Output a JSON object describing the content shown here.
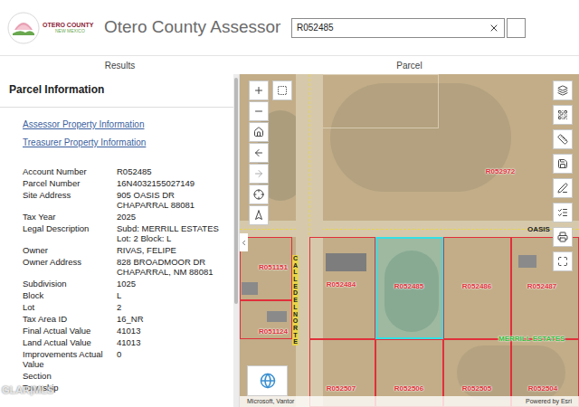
{
  "header": {
    "logo": {
      "line1": "OTERO COUNTY",
      "line2": "NEW MEXICO"
    },
    "title": "Otero County Assessor",
    "search": {
      "value": "R052485"
    }
  },
  "panes": [
    {
      "label": "Results"
    },
    {
      "label": "Parcel"
    }
  ],
  "parcel_info": {
    "title": "Parcel Information",
    "links": [
      "Assessor Property Information",
      "Treasurer Property Information"
    ],
    "fields": [
      {
        "label": "Account Number",
        "value": [
          "R052485"
        ]
      },
      {
        "label": "Parcel Number",
        "value": [
          "16N4032155027149"
        ]
      },
      {
        "label": "Site Address",
        "value": [
          "905 OASIS DR",
          "CHAPARRAL 88081"
        ]
      },
      {
        "label": "Tax Year",
        "value": [
          "2025"
        ]
      },
      {
        "label": "Legal Description",
        "value": [
          "Subd: MERRILL ESTATES",
          "Lot: 2 Block: L"
        ]
      },
      {
        "label": "Owner",
        "value": [
          "RIVAS, FELIPE"
        ]
      },
      {
        "label": "Owner Address",
        "value": [
          "828 BROADMOOR DR",
          "CHAPARRAL, NM 88081"
        ]
      },
      {
        "label": "Subdivision",
        "value": [
          "1025"
        ]
      },
      {
        "label": "Block",
        "value": [
          "L"
        ]
      },
      {
        "label": "Lot",
        "value": [
          "2"
        ]
      },
      {
        "label": "Tax Area ID",
        "value": [
          "16_NR"
        ]
      },
      {
        "label": "Final Actual Value",
        "value": [
          "41013"
        ]
      },
      {
        "label": "Land Actual Value",
        "value": [
          "41013"
        ]
      },
      {
        "label": "Improvements Actual Value",
        "value": [
          "0"
        ]
      },
      {
        "label": "Section",
        "value": []
      },
      {
        "label": "Township",
        "value": []
      }
    ]
  },
  "map": {
    "parcels": [
      {
        "label": "R052972",
        "selected": false
      },
      {
        "label": "R052484",
        "selected": false
      },
      {
        "label": "R052485",
        "selected": true
      },
      {
        "label": "R052486",
        "selected": false
      },
      {
        "label": "R052487",
        "selected": false
      },
      {
        "label": "R051151",
        "selected": false
      },
      {
        "label": "R051124",
        "selected": false
      },
      {
        "label": "R052507",
        "selected": false
      },
      {
        "label": "R052506",
        "selected": false
      },
      {
        "label": "R052505",
        "selected": false
      },
      {
        "label": "R052504",
        "selected": false
      }
    ],
    "streets": [
      {
        "name": "OASIS",
        "kind": "horizontal"
      },
      {
        "name": "CALLE DEL NORTE",
        "kind": "vertical"
      }
    ],
    "subdivision_label": "MERRILL ESTATES",
    "attribution": "Microsoft, Vantor",
    "powered_by": "Powered by Esri"
  },
  "watermark": "GLAR|MLS"
}
